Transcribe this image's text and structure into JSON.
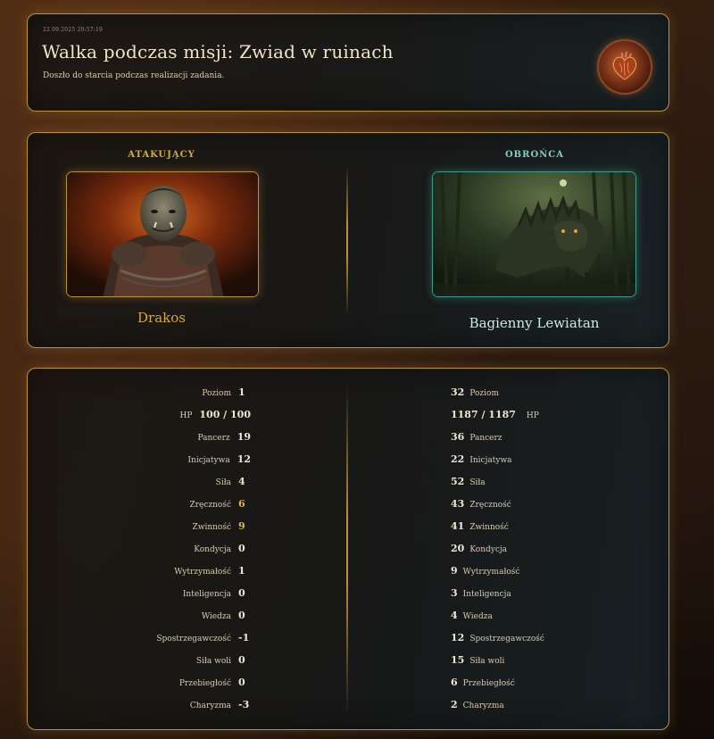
{
  "header": {
    "timestamp": "22.09.2025 20:57:19",
    "title": "Walka podczas misji: Zwiad w ruinach",
    "subtitle": "Doszło do starcia podczas realizacji zadania.",
    "badge_icon": "anatomical-heart-icon"
  },
  "combatants": {
    "attacker": {
      "role": "ATAKUJĄCY",
      "name": "Drakos",
      "portrait": "orc-warrior-portrait",
      "accent": "#d6a83e"
    },
    "defender": {
      "role": "OBROŃCA",
      "name": "Bagienny Lewiatan",
      "portrait": "swamp-beast-portrait",
      "accent": "#7fcfc3"
    }
  },
  "stats": {
    "hp_label": "HP",
    "hp_left": "100 / 100",
    "hp_right": "1187 / 1187",
    "rows": [
      {
        "label": "Poziom",
        "left": "1",
        "right": "32"
      },
      {
        "label": "Pancerz",
        "left": "19",
        "right": "36"
      },
      {
        "label": "Inicjatywa",
        "left": "12",
        "right": "22"
      },
      {
        "label": "Siła",
        "left": "4",
        "right": "52"
      },
      {
        "label": "Zręczność",
        "left": "6",
        "right": "43"
      },
      {
        "label": "Zwinność",
        "left": "9",
        "right": "41"
      },
      {
        "label": "Kondycja",
        "left": "0",
        "right": "20"
      },
      {
        "label": "Wytrzymałość",
        "left": "1",
        "right": "9"
      },
      {
        "label": "Inteligencja",
        "left": "0",
        "right": "3"
      },
      {
        "label": "Wiedza",
        "left": "0",
        "right": "4"
      },
      {
        "label": "Spostrzegawczość",
        "left": "-1",
        "right": "12"
      },
      {
        "label": "Siła woli",
        "left": "0",
        "right": "15"
      },
      {
        "label": "Przebiegłość",
        "left": "0",
        "right": "6"
      },
      {
        "label": "Charyzma",
        "left": "-3",
        "right": "2"
      }
    ],
    "highlight_color": "#e0b83a"
  }
}
